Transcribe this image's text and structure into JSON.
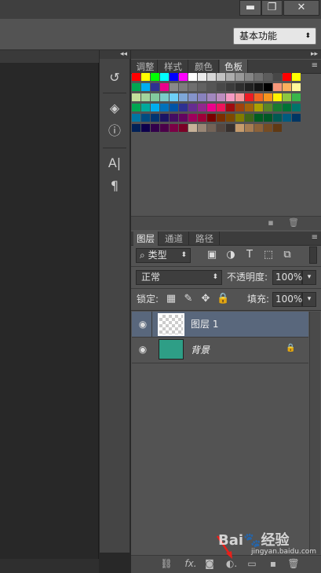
{
  "window": {
    "minimize_glyph": "▬",
    "restore_glyph": "❐",
    "close_glyph": "✕"
  },
  "options_bar": {
    "workspace_value": "基本功能",
    "workspace_arrow": "⬍"
  },
  "icon_strip": {
    "collapse_glyph": "◂◂",
    "icons": [
      {
        "name": "history-icon",
        "glyph": "↺"
      },
      {
        "name": "3d-icon",
        "glyph": "◈"
      },
      {
        "name": "info-icon",
        "glyph": "ⓘ"
      },
      {
        "name": "character-icon",
        "glyph": "A|"
      },
      {
        "name": "paragraph-icon",
        "glyph": "¶"
      }
    ]
  },
  "color_panel": {
    "collapse_glyph": "▸▸",
    "menu_glyph": "≡",
    "tabs": [
      "调整",
      "样式",
      "颜色",
      "色板"
    ],
    "active_tab": 3,
    "swatch_rows": [
      [
        "#ff0000",
        "#ffff00",
        "#00ff00",
        "#00ffff",
        "#0000ff",
        "#ff00ff",
        "#ffffff",
        "#ebebeb",
        "#d6d6d6",
        "#c2c2c2",
        "#adadad",
        "#999999",
        "#858585",
        "#707070",
        "#5c5c5c",
        "#474747",
        "#ff0000",
        "#ffff00"
      ],
      [
        "#00a651",
        "#00aeef",
        "#2e3192",
        "#ec008c",
        "#898989",
        "#7d7d7d",
        "#6f6f6f",
        "#626262",
        "#555555",
        "#484848",
        "#3b3b3b",
        "#2e2e2e",
        "#212121",
        "#141414",
        "#000000",
        "#f7977a",
        "#fbaf5d",
        "#fff79a"
      ],
      [
        "#c4df9b",
        "#a3d39c",
        "#82ca9d",
        "#7accc8",
        "#6dcff6",
        "#7ea7d8",
        "#8493ca",
        "#8882be",
        "#a187be",
        "#bc8dbf",
        "#f49ac2",
        "#f6989d",
        "#ed1c24",
        "#f26522",
        "#f7941d",
        "#fff200",
        "#8dc63f",
        "#39b54a"
      ],
      [
        "#00a651",
        "#00a99d",
        "#00aeef",
        "#0072bc",
        "#0054a6",
        "#2e3192",
        "#662d91",
        "#92278f",
        "#ec008c",
        "#ed145b",
        "#9e0b0f",
        "#a0410d",
        "#a3620a",
        "#aba000",
        "#598527",
        "#197b30",
        "#007236",
        "#00746b"
      ],
      [
        "#0076a3",
        "#004b80",
        "#003471",
        "#1b1464",
        "#440e62",
        "#630460",
        "#9e005d",
        "#9e0039",
        "#790000",
        "#7b2e00",
        "#7d4900",
        "#827b00",
        "#406618",
        "#005e20",
        "#005826",
        "#005952",
        "#005b7f",
        "#003663"
      ],
      [
        "#002157",
        "#0d004c",
        "#32004b",
        "#4b0049",
        "#7b0046",
        "#7a0026",
        "#c7b299",
        "#998675",
        "#736357",
        "#534741",
        "#37302d",
        "#c69c6d",
        "#a67c52",
        "#8c6239",
        "#754c24",
        "#603913"
      ]
    ],
    "footer_new_glyph": "▪",
    "footer_delete_glyph": "🗑"
  },
  "layers_panel": {
    "tabs": [
      "图层",
      "通道",
      "路径"
    ],
    "active_tab": 0,
    "menu_glyph": "≡",
    "filter_label": "类型",
    "filter_search_glyph": "⌕",
    "filter_icons": [
      {
        "name": "pixel-filter-icon",
        "glyph": "▣"
      },
      {
        "name": "adjustment-filter-icon",
        "glyph": "◑"
      },
      {
        "name": "type-filter-icon",
        "glyph": "T"
      },
      {
        "name": "shape-filter-icon",
        "glyph": "⬚"
      },
      {
        "name": "smart-object-filter-icon",
        "glyph": "⧉"
      }
    ],
    "blend_mode": "正常",
    "opacity_label": "不透明度:",
    "opacity_value": "100%",
    "lock_label": "锁定:",
    "fill_label": "填充:",
    "fill_value": "100%",
    "lock_icons": [
      {
        "name": "lock-transparency-icon",
        "glyph": "▦"
      },
      {
        "name": "lock-image-icon",
        "glyph": "✎"
      },
      {
        "name": "lock-position-icon",
        "glyph": "✥"
      },
      {
        "name": "lock-all-icon",
        "glyph": "🔒"
      }
    ],
    "layers": [
      {
        "name": "图层 1",
        "selected": true,
        "thumb": "transparent",
        "locked": false
      },
      {
        "name": "背景",
        "selected": false,
        "thumb": "#2e9e86",
        "locked": true
      }
    ],
    "eye_glyph": "◉",
    "lock_glyph": "🔒",
    "footer_icons": [
      {
        "name": "link-layers-icon",
        "glyph": "⛓"
      },
      {
        "name": "layer-style-icon",
        "glyph": "fx."
      },
      {
        "name": "add-mask-icon",
        "glyph": "◙"
      },
      {
        "name": "adjustment-layer-icon",
        "glyph": "◐."
      },
      {
        "name": "new-group-icon",
        "glyph": "▭"
      },
      {
        "name": "new-layer-icon",
        "glyph": "▪"
      },
      {
        "name": "delete-layer-icon",
        "glyph": "🗑"
      }
    ]
  },
  "watermark": {
    "logo": "Bai🐾经验",
    "url": "jingyan.baidu.com"
  }
}
